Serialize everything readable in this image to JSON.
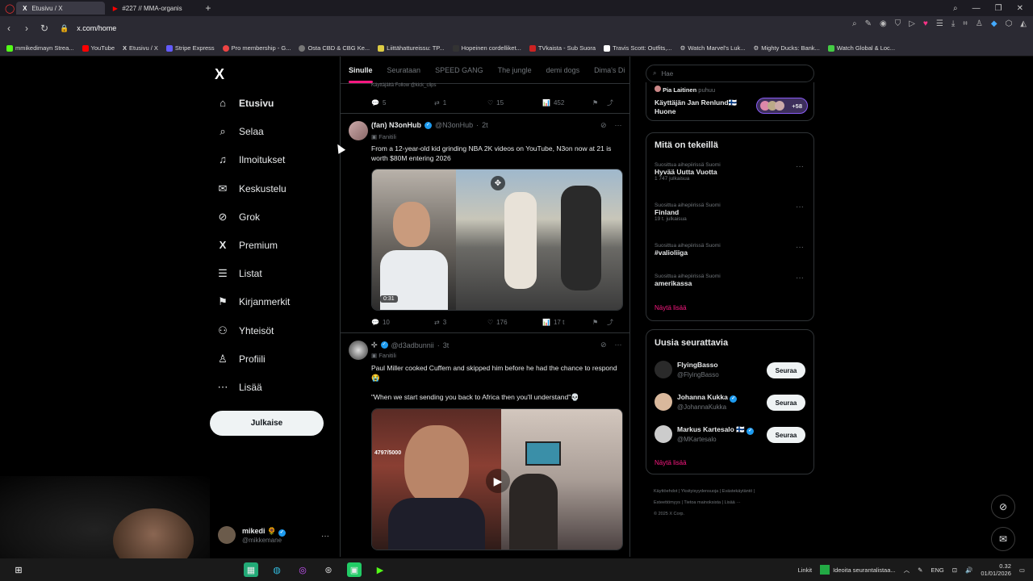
{
  "browser": {
    "tabs": [
      {
        "label": "Etusivu / X",
        "active": true
      },
      {
        "label": "#227 // MMA-organis",
        "active": false
      }
    ],
    "url": "x.com/home",
    "bookmarks": [
      "mmikedimayn Strea...",
      "YouTube",
      "Etusivu / X",
      "Stripe Express",
      "Pro membership - G...",
      "Osta CBD & CBG Ke...",
      "Liittähattureissu: TP...",
      "Hopeinen cordelliket...",
      "TVkaista - Sub Suora",
      "Travis Scott: Outfits,...",
      "Watch Marvel's Luk...",
      "Mighty Ducks: Bank...",
      "Watch Global & Loc..."
    ]
  },
  "sidebar": {
    "logo": "X",
    "items": [
      {
        "label": "Etusivu",
        "icon": "home-icon",
        "glyph": "⌂"
      },
      {
        "label": "Selaa",
        "icon": "search-icon",
        "glyph": "⌕"
      },
      {
        "label": "Ilmoitukset",
        "icon": "bell-icon",
        "glyph": "🔔"
      },
      {
        "label": "Keskustelu",
        "icon": "mail-icon",
        "glyph": "✉"
      },
      {
        "label": "Grok",
        "icon": "grok-icon",
        "glyph": "⊘"
      },
      {
        "label": "Premium",
        "icon": "x-icon",
        "glyph": "X"
      },
      {
        "label": "Listat",
        "icon": "list-icon",
        "glyph": "☰"
      },
      {
        "label": "Kirjanmerkit",
        "icon": "bookmark-icon",
        "glyph": "⚑"
      },
      {
        "label": "Yhteisöt",
        "icon": "communities-icon",
        "glyph": "⚇"
      },
      {
        "label": "Profiili",
        "icon": "profile-icon",
        "glyph": "♙"
      },
      {
        "label": "Lisää",
        "icon": "more-icon",
        "glyph": "⋯"
      }
    ],
    "post_button": "Julkaise",
    "user": {
      "name": "mikedi",
      "handle": "@mikkemane"
    }
  },
  "feed": {
    "tabs": [
      "Sinulle",
      "Seurataan",
      "SPEED GANG",
      "The jungle",
      "demi dogs",
      "Dima's Di"
    ],
    "partial_line": "Käyttäjältä Follow @kick_clips",
    "top_actions": {
      "replies": "5",
      "reposts": "1",
      "likes": "15",
      "views": "452"
    },
    "tweets": [
      {
        "name": "(fan) N3onHub",
        "handle": "@N3onHub",
        "time": "2t",
        "badge": "Fanitili",
        "text": "From a 12-year-old kid grinding NBA 2K videos on YouTube, N3on now at 21 is worth $80M entering 2026",
        "video_time": "0:31",
        "replies": "10",
        "reposts": "3",
        "likes": "176",
        "views": "17 t"
      },
      {
        "name": "",
        "handle": "@d3adbunnii",
        "time": "3t",
        "badge": "Fanitili",
        "text": "Paul Miller cooked Cuffem and skipped him before he had the chance to respond😭",
        "quote": "\"When we start sending you back to Africa then you'll understand\"💀"
      }
    ]
  },
  "right": {
    "search_placeholder": "Hae",
    "spaces": {
      "host": "Pia Laitinen",
      "host_suffix": "puhuu",
      "title": "Käyttäjän Jan Renlund🇫🇮 Huone",
      "count": "+58"
    },
    "trends": {
      "title": "Mitä on tekeillä",
      "items": [
        {
          "meta": "Suosittua aihepiirissä Suomi",
          "name": "Hyvää Uutta Vuotta",
          "count": "1 747 julkaisua"
        },
        {
          "meta": "Suosittua aihepiirissä Suomi",
          "name": "Finland",
          "count": "19 t. julkaisua"
        },
        {
          "meta": "Suosittua aihepiirissä Suomi",
          "name": "#valioliiga",
          "count": ""
        },
        {
          "meta": "Suosittua aihepiirissä Suomi",
          "name": "amerikassa",
          "count": ""
        }
      ],
      "more": "Näytä lisää"
    },
    "who": {
      "title": "Uusia seurattavia",
      "items": [
        {
          "name": "FlyingBasso",
          "handle": "@FlyingBasso",
          "verified": false
        },
        {
          "name": "Johanna Kukka",
          "handle": "@JohannaKukka",
          "verified": true
        },
        {
          "name": "Markus Kartesalo 🇫🇮",
          "handle": "@MKartesalo",
          "verified": true
        }
      ],
      "button": "Seuraa",
      "more": "Näytä lisää"
    },
    "footer": [
      "Käyttöehdot",
      "Yksityisyydensuoja",
      "Evästekäytäntö",
      "Esteettömyys",
      "Tietoa mainoksista",
      "Lisää ···",
      "© 2025 X Corp."
    ]
  },
  "taskbar": {
    "links": "Linkit",
    "notification": "Ideoita seurantalistaa...",
    "lang": "ENG",
    "time": "0.32",
    "date": "01/01/2026"
  },
  "colors": {
    "accent": "#f91880",
    "verified": "#1d9bf0",
    "border": "#2f3336"
  }
}
